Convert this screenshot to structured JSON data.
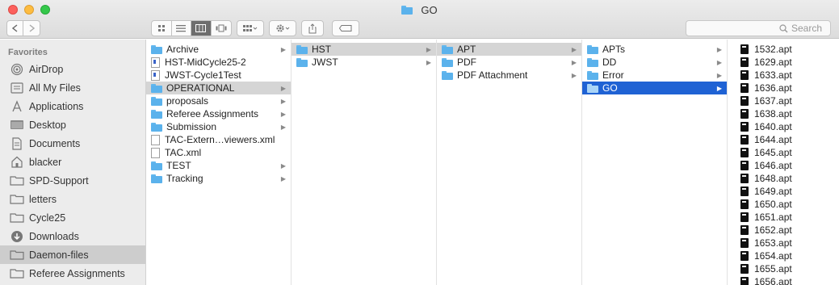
{
  "window": {
    "title": "GO"
  },
  "search": {
    "placeholder": "Search"
  },
  "sidebar": {
    "header": "Favorites",
    "items": [
      {
        "label": "AirDrop",
        "icon": "airdrop-icon"
      },
      {
        "label": "All My Files",
        "icon": "all-files-icon"
      },
      {
        "label": "Applications",
        "icon": "applications-icon"
      },
      {
        "label": "Desktop",
        "icon": "desktop-icon"
      },
      {
        "label": "Documents",
        "icon": "documents-icon"
      },
      {
        "label": "blacker",
        "icon": "home-icon"
      },
      {
        "label": "SPD-Support",
        "icon": "folder-icon"
      },
      {
        "label": "letters",
        "icon": "folder-icon"
      },
      {
        "label": "Cycle25",
        "icon": "folder-icon"
      },
      {
        "label": "Downloads",
        "icon": "downloads-icon"
      },
      {
        "label": "Daemon-files",
        "icon": "folder-icon",
        "selected": true
      },
      {
        "label": "Referee Assignments",
        "icon": "folder-icon"
      }
    ]
  },
  "columns": {
    "col1": [
      {
        "label": "Archive",
        "type": "folder",
        "chevron": true
      },
      {
        "label": "HST-MidCycle25-2",
        "type": "doc-blue",
        "chevron": false
      },
      {
        "label": "JWST-Cycle1Test",
        "type": "doc-blue",
        "chevron": false
      },
      {
        "label": "OPERATIONAL",
        "type": "folder",
        "chevron": true,
        "state": "path"
      },
      {
        "label": "proposals",
        "type": "folder",
        "chevron": true
      },
      {
        "label": "Referee Assignments",
        "type": "folder",
        "chevron": true
      },
      {
        "label": "Submission",
        "type": "folder",
        "chevron": true
      },
      {
        "label": "TAC-Extern…viewers.xml",
        "type": "doc",
        "chevron": false
      },
      {
        "label": "TAC.xml",
        "type": "doc",
        "chevron": false
      },
      {
        "label": "TEST",
        "type": "folder",
        "chevron": true
      },
      {
        "label": "Tracking",
        "type": "folder",
        "chevron": true
      }
    ],
    "col2": [
      {
        "label": "HST",
        "type": "folder",
        "chevron": true,
        "state": "path"
      },
      {
        "label": "JWST",
        "type": "folder",
        "chevron": true
      }
    ],
    "col3": [
      {
        "label": "APT",
        "type": "folder",
        "chevron": true,
        "state": "path"
      },
      {
        "label": "PDF",
        "type": "folder",
        "chevron": true
      },
      {
        "label": "PDF Attachment",
        "type": "folder",
        "chevron": true
      }
    ],
    "col4": [
      {
        "label": "APTs",
        "type": "folder",
        "chevron": true
      },
      {
        "label": "DD",
        "type": "folder",
        "chevron": true
      },
      {
        "label": "Error",
        "type": "folder",
        "chevron": true
      },
      {
        "label": "GO",
        "type": "folder",
        "chevron": true,
        "state": "sel"
      }
    ],
    "col5": [
      {
        "label": "1532.apt",
        "type": "apt"
      },
      {
        "label": "1629.apt",
        "type": "apt"
      },
      {
        "label": "1633.apt",
        "type": "apt"
      },
      {
        "label": "1636.apt",
        "type": "apt"
      },
      {
        "label": "1637.apt",
        "type": "apt"
      },
      {
        "label": "1638.apt",
        "type": "apt"
      },
      {
        "label": "1640.apt",
        "type": "apt"
      },
      {
        "label": "1644.apt",
        "type": "apt"
      },
      {
        "label": "1645.apt",
        "type": "apt"
      },
      {
        "label": "1646.apt",
        "type": "apt"
      },
      {
        "label": "1648.apt",
        "type": "apt"
      },
      {
        "label": "1649.apt",
        "type": "apt"
      },
      {
        "label": "1650.apt",
        "type": "apt"
      },
      {
        "label": "1651.apt",
        "type": "apt"
      },
      {
        "label": "1652.apt",
        "type": "apt"
      },
      {
        "label": "1653.apt",
        "type": "apt"
      },
      {
        "label": "1654.apt",
        "type": "apt"
      },
      {
        "label": "1655.apt",
        "type": "apt"
      },
      {
        "label": "1656.apt",
        "type": "apt"
      }
    ]
  }
}
